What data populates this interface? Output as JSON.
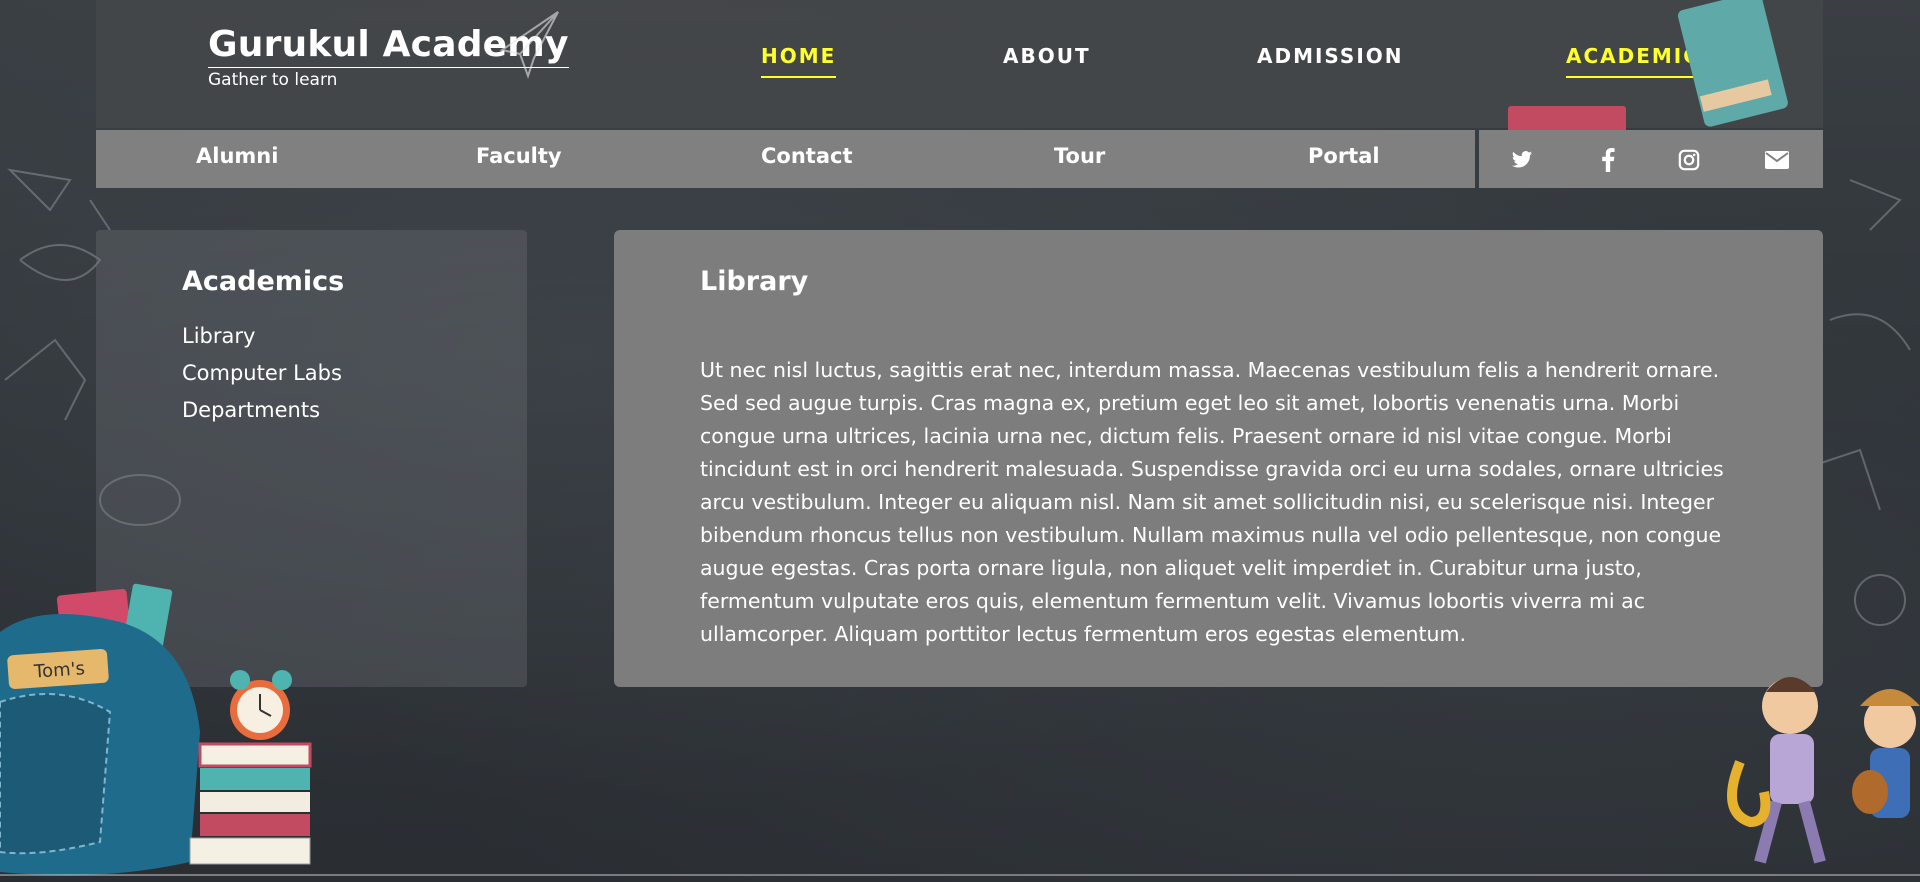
{
  "brand": {
    "title": "Gurukul Academy",
    "tagline": "Gather to learn"
  },
  "main_nav": [
    {
      "label": "HOME",
      "active": true
    },
    {
      "label": "ABOUT",
      "active": false
    },
    {
      "label": "ADMISSION",
      "active": false
    },
    {
      "label": "ACADEMICS",
      "active": true
    }
  ],
  "sub_nav": [
    "Alumni",
    "Faculty",
    "Contact",
    "Tour",
    "Portal"
  ],
  "social": [
    "twitter-icon",
    "facebook-icon",
    "instagram-icon",
    "email-icon"
  ],
  "sidebar": {
    "heading": "Academics",
    "items": [
      "Library",
      "Computer Labs",
      "Departments"
    ]
  },
  "main": {
    "heading": "Library",
    "body": "Ut nec nisl luctus, sagittis erat nec, interdum massa. Maecenas vestibulum felis a hendrerit ornare. Sed sed augue turpis. Cras magna ex, pretium eget leo sit amet, lobortis venenatis urna. Morbi congue urna ultrices, lacinia urna nec, dictum felis. Praesent ornare id nisl vitae congue. Morbi tincidunt est in orci hendrerit malesuada. Suspendisse gravida orci eu urna sodales, ornare ultricies arcu vestibulum. Integer eu aliquam nisl. Nam sit amet sollicitudin nisi, eu scelerisque nisi. Integer bibendum rhoncus tellus non vestibulum. Nullam maximus nulla vel odio pellentesque, non congue augue egestas. Cras porta ornare ligula, non aliquet velit imperdiet in. Curabitur urna justo, fermentum vulputate eros quis, elementum fermentum velit. Vivamus lobortis viverra mi ac ullamcorper. Aliquam porttitor lectus fermentum eros egestas elementum."
  },
  "decor": {
    "backpack_tag": "Tom's"
  },
  "colors": {
    "accent": "#ffff2a",
    "panel": "#7d7d7d",
    "subnav": "#808080"
  }
}
